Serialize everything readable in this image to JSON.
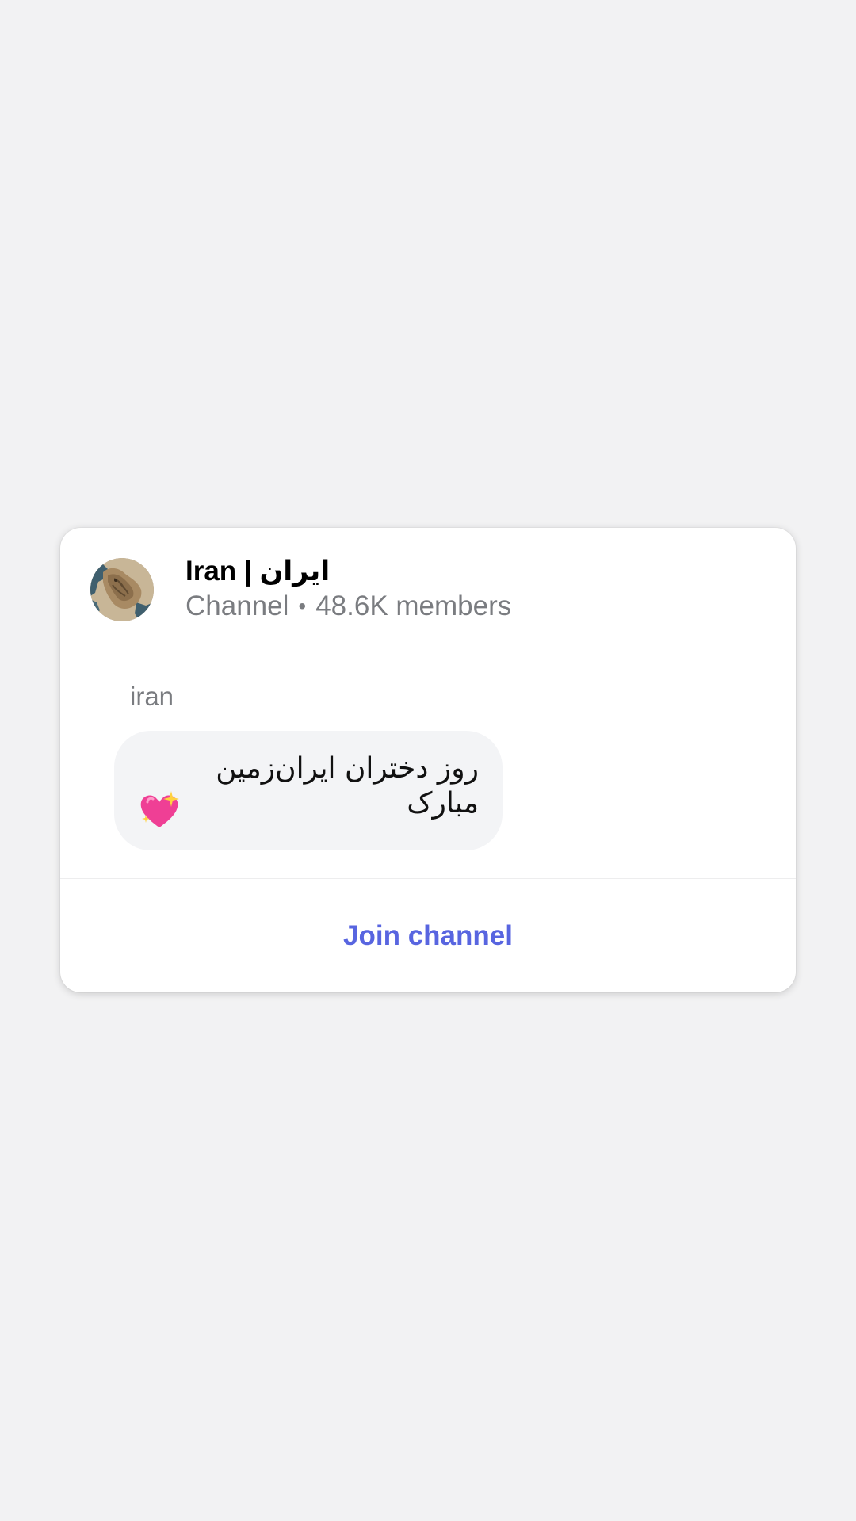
{
  "channel": {
    "title": "Iran | ایران",
    "type_label": "Channel",
    "separator": "•",
    "members": "48.6K members",
    "avatar_icon": "iran-map-lion-avatar"
  },
  "message": {
    "author": "iran",
    "text": "روز دختران ایران‌زمین مبارک",
    "emoji_icon": "sparkling-heart-icon"
  },
  "actions": {
    "join_label": "Join channel"
  },
  "colors": {
    "background": "#f2f2f3",
    "card": "#ffffff",
    "bubble": "#f3f4f6",
    "accent": "#5865e0",
    "secondary_text": "#7a7c80"
  }
}
